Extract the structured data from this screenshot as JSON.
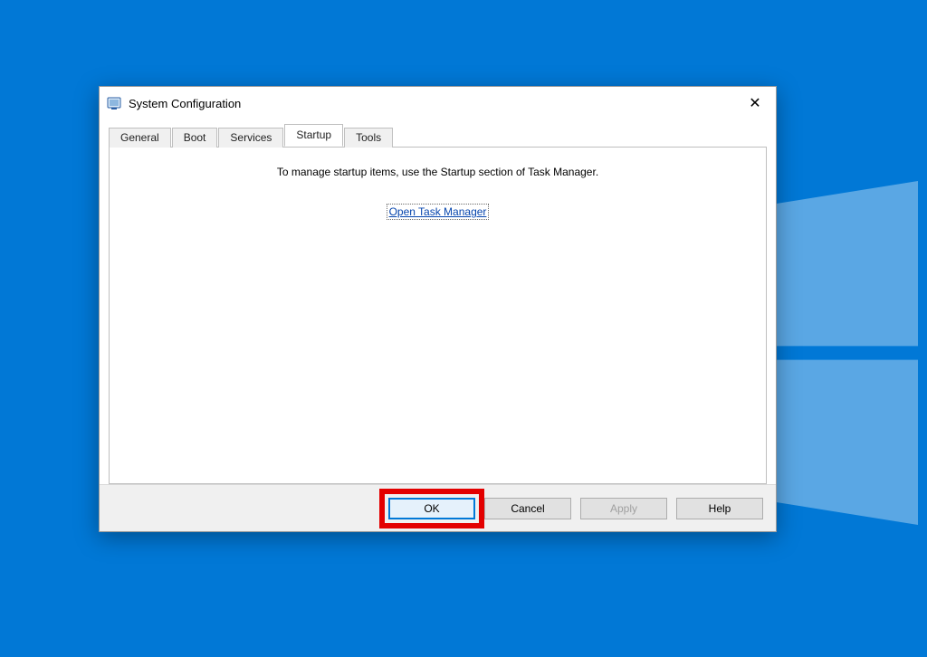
{
  "dialog": {
    "title": "System Configuration",
    "close_symbol": "✕"
  },
  "tabs": {
    "general": "General",
    "boot": "Boot",
    "services": "Services",
    "startup": "Startup",
    "tools": "Tools",
    "active": "startup"
  },
  "startup_panel": {
    "message": "To manage startup items, use the Startup section of Task Manager.",
    "link_label": "Open Task Manager"
  },
  "buttons": {
    "ok": "OK",
    "cancel": "Cancel",
    "apply": "Apply",
    "help": "Help"
  }
}
